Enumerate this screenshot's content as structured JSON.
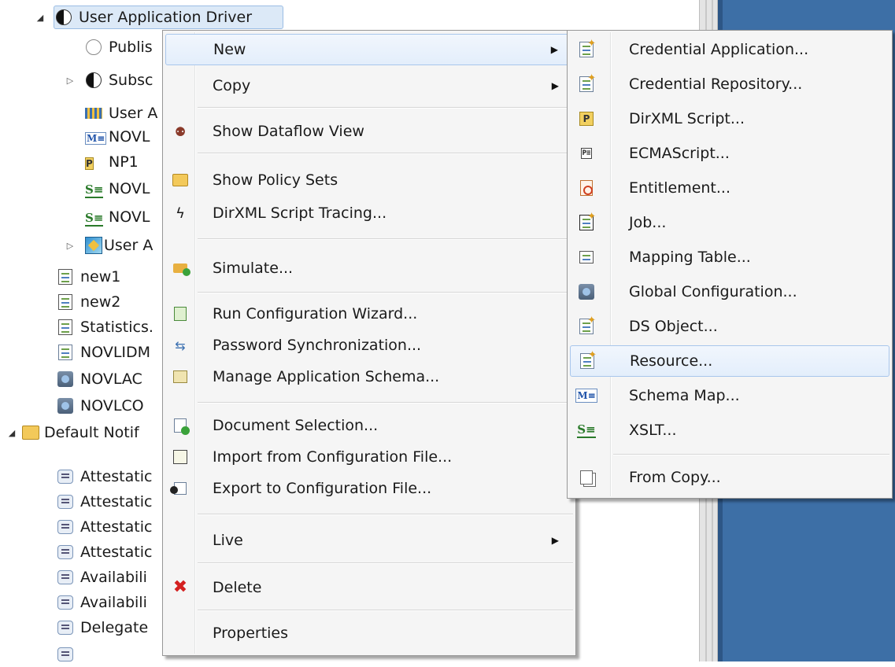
{
  "tree": {
    "root_label": "User Application Driver",
    "children": [
      {
        "label": "Publis",
        "icon": "publisher-icon"
      },
      {
        "label": "Subsc",
        "icon": "subscriber-icon"
      },
      {
        "label": "User A",
        "icon": "driver-config-icon"
      },
      {
        "label": "NOVL",
        "icon": "schema-map-icon"
      },
      {
        "label": "NP1",
        "icon": "policy-icon"
      },
      {
        "label": "NOVL",
        "icon": "xslt-icon"
      },
      {
        "label": "NOVL",
        "icon": "xslt-icon"
      },
      {
        "label": "User A",
        "icon": "user-app-icon"
      },
      {
        "label": "new1",
        "icon": "job-icon"
      },
      {
        "label": "new2",
        "icon": "job-icon"
      },
      {
        "label": "Statistics.",
        "icon": "job-icon"
      },
      {
        "label": "NOVLIDM",
        "icon": "resource-icon"
      },
      {
        "label": "NOVLAC",
        "icon": "global-config-icon"
      },
      {
        "label": "NOVLCO",
        "icon": "global-config-icon"
      }
    ],
    "notification_root": "Default Notif",
    "notifications": [
      "Attestatic",
      "Attestatic",
      "Attestatic",
      "Attestatic",
      "Availabili",
      "Availabili",
      "Delegate"
    ]
  },
  "context_menu": {
    "items": [
      {
        "label": "New",
        "has_submenu": true
      },
      {
        "label": "Copy",
        "has_submenu": true
      },
      {
        "label": "Show Dataflow View"
      },
      {
        "label": "Show Policy Sets"
      },
      {
        "label": "DirXML Script Tracing..."
      },
      {
        "label": "Simulate..."
      },
      {
        "label": "Run Configuration Wizard..."
      },
      {
        "label": "Password Synchronization..."
      },
      {
        "label": "Manage Application Schema..."
      },
      {
        "label": "Document Selection..."
      },
      {
        "label": "Import from Configuration File..."
      },
      {
        "label": "Export to Configuration File..."
      },
      {
        "label": "Live",
        "has_submenu": true
      },
      {
        "label": "Delete"
      },
      {
        "label": "Properties"
      }
    ],
    "submenu_arrow": "▶"
  },
  "new_submenu": {
    "items": [
      {
        "label": "Credential Application..."
      },
      {
        "label": "Credential Repository..."
      },
      {
        "label": "DirXML Script..."
      },
      {
        "label": "ECMAScript..."
      },
      {
        "label": "Entitlement..."
      },
      {
        "label": "Job..."
      },
      {
        "label": "Mapping Table..."
      },
      {
        "label": "Global Configuration..."
      },
      {
        "label": "DS Object..."
      },
      {
        "label": "Resource..."
      },
      {
        "label": "Schema Map..."
      },
      {
        "label": "XSLT..."
      },
      {
        "label": "From Copy..."
      }
    ],
    "hovered": "Resource..."
  },
  "colors": {
    "selection": "#dce9f7",
    "menu_bg": "#f5f5f5",
    "hover_border": "#a8c6ec",
    "panel_blue": "#3d6fa6"
  }
}
